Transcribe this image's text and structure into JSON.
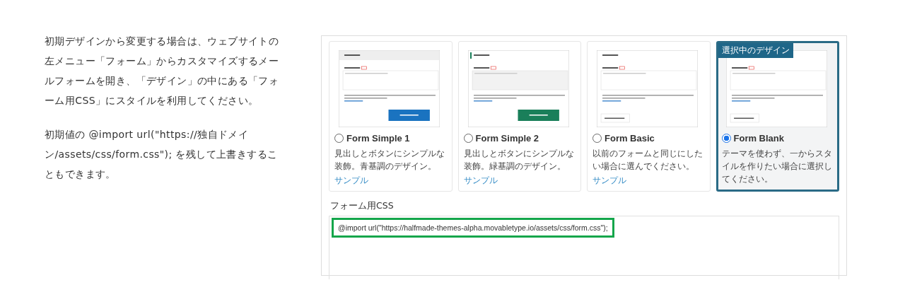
{
  "intro": {
    "paragraphs": [
      "初期デザインから変更する場合は、ウェブサイトの左メニュー「フォーム」からカスタマイズするメールフォームを開き、「デザイン」の中にある「フォーム用CSS」にスタイルを利用してください。",
      "初期値の @import url(\"https://独自ドメイン/assets/css/form.css\"); を残して上書きすることもできます。"
    ]
  },
  "designs": [
    {
      "name": "Form Simple 1",
      "description": "見出しとボタンにシンプルな装飾。青基調のデザイン。",
      "sample_link": "サンプル",
      "kind": "blue",
      "selected": false
    },
    {
      "name": "Form Simple 2",
      "description": "見出しとボタンにシンプルな装飾。緑基調のデザイン。",
      "sample_link": "サンプル",
      "kind": "green",
      "selected": false
    },
    {
      "name": "Form Basic",
      "description": "以前のフォームと同じにしたい場合に選んでください。",
      "sample_link": "サンプル",
      "kind": "basic",
      "selected": false
    },
    {
      "name": "Form Blank",
      "description": "テーマを使わず、一からスタイルを作りたい場合に選択してください。",
      "kind": "blank",
      "selected": true
    }
  ],
  "selected_badge": "選択中のデザイン",
  "css_section": {
    "label": "フォーム用CSS",
    "value": "@import url(\"https://halfmade-themes-alpha.movabletype.io/assets/css/form.css\");",
    "highlighted": true
  }
}
